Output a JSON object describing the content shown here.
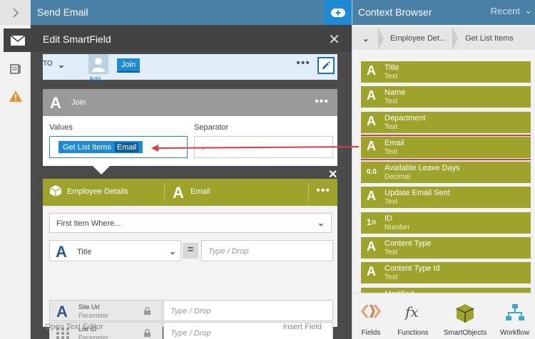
{
  "top_bar": {
    "title": "Send Email"
  },
  "modal": {
    "title": "Edit SmartField",
    "to_row": {
      "label": "TO",
      "add_label": "Add",
      "token": "Join"
    },
    "join_panel": {
      "name": "Join",
      "values_label": "Values",
      "separator_label": "Separator",
      "values_token_source": "Get List Items",
      "values_token_field": "Email",
      "separator_value": ","
    },
    "employee_panel": {
      "source_name": "Employee Details",
      "field_name": "Email",
      "first_item_select": "First Item Where...",
      "condition": {
        "field": "Title",
        "operator_symbol": "=",
        "value_placeholder": "Type / Drop"
      },
      "parameters": [
        {
          "name": "Site Url",
          "kind": "Parameter",
          "placeholder": "Type / Drop"
        },
        {
          "name": "List ID",
          "kind": "Parameter",
          "placeholder": "Type / Drop"
        }
      ]
    },
    "footer_left": "Open Text Editor",
    "footer_right": "Insert Field"
  },
  "context_browser": {
    "title": "Context Browser",
    "recent_label": "Recent",
    "breadcrumbs": [
      "Employee Det...",
      "Get List Items"
    ],
    "items": [
      {
        "name": "Title",
        "type": "Text",
        "icon": "text-icon"
      },
      {
        "name": "Name",
        "type": "Text",
        "icon": "text-icon"
      },
      {
        "name": "Department",
        "type": "Text",
        "icon": "text-icon"
      },
      {
        "name": "Email",
        "type": "Text",
        "icon": "text-icon",
        "highlighted": true
      },
      {
        "name": "Available Leave Days",
        "type": "Decimal",
        "icon": "decimal-icon"
      },
      {
        "name": "Update Email Sent",
        "type": "Text",
        "icon": "text-icon"
      },
      {
        "name": "ID",
        "type": "Number",
        "icon": "number-icon"
      },
      {
        "name": "Content Type",
        "type": "Text",
        "icon": "text-icon"
      },
      {
        "name": "Content Type Id",
        "type": "Text",
        "icon": "text-icon"
      },
      {
        "name": "Modified",
        "type": "",
        "icon": "date-icon"
      }
    ],
    "bottom_tabs": [
      "Fields",
      "Functions",
      "SmartObjects",
      "Workflow"
    ]
  },
  "colors": {
    "accent_blue": "#1e8ad6",
    "header_blue": "#4a7fa6",
    "olive": "#9ea32c",
    "highlight_red": "#e0393e"
  }
}
